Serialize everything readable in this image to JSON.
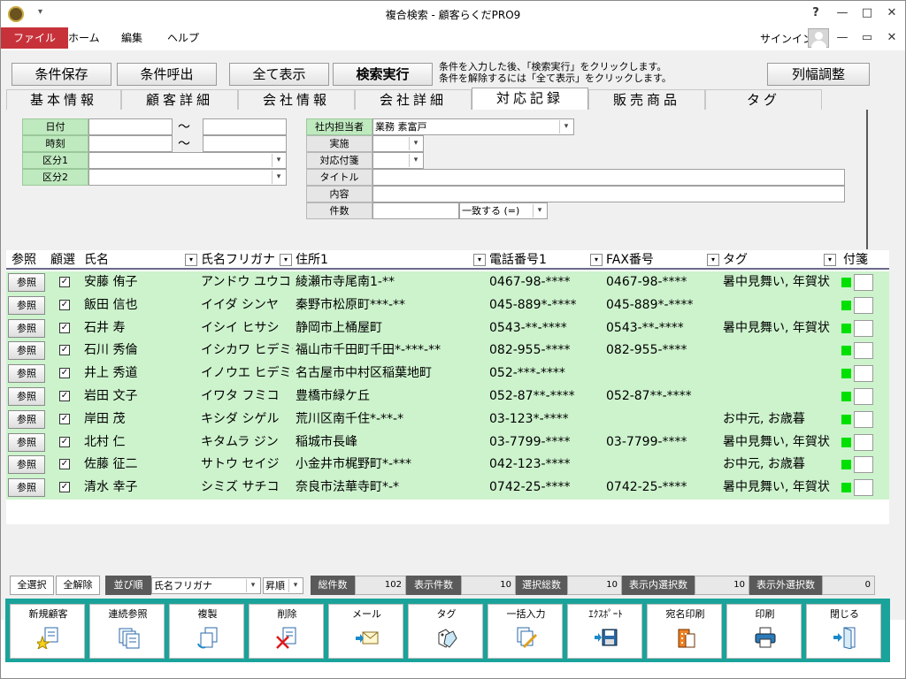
{
  "window": {
    "title": "複合検索 - 顧客らくだPRO9",
    "signin": "サインイン",
    "help": "?",
    "minimize": "—",
    "maximize": "□",
    "close": "✕",
    "ribbon_min": "—",
    "ribbon_restore": "▭",
    "ribbon_close": "✕",
    "qa": "▾"
  },
  "menu": [
    "ファイル",
    "ホーム",
    "編集",
    "ヘルプ"
  ],
  "toolbar": {
    "save": "条件保存",
    "load": "条件呼出",
    "show_all": "全て表示",
    "execute": "検索実行",
    "hint1": "条件を入力した後、「検索実行」をクリックします。",
    "hint2": "条件を解除するには「全て表示」をクリックします。",
    "col_adjust": "列幅調整"
  },
  "tabs": [
    "基本情報",
    "顧客詳細",
    "会社情報",
    "会社詳細",
    "対応記録",
    "販売商品",
    "タグ"
  ],
  "search": {
    "date": "日付",
    "time": "時刻",
    "kubun1": "区分1",
    "kubun2": "区分2",
    "tilde": "〜",
    "tantou": "社内担当者",
    "tantou_val": "業務 素富戸",
    "jisshi": "実施",
    "fusen": "対応付箋",
    "title": "タイトル",
    "naiyou": "内容",
    "kensu": "件数",
    "match": "一致する (=)"
  },
  "columns": [
    "参照",
    "顧選",
    "氏名",
    "氏名フリガナ",
    "住所1",
    "電話番号1",
    "FAX番号",
    "タグ",
    "付箋"
  ],
  "ref_label": "参照",
  "rows": [
    {
      "name": "安藤 侑子",
      "kana": "アンドウ ユウコ",
      "addr": "綾瀬市寺尾南1-**",
      "tel": "0467-98-****",
      "fax": "0467-98-****",
      "tag": "暑中見舞い, 年賀状"
    },
    {
      "name": "飯田 信也",
      "kana": "イイダ シンヤ",
      "addr": "秦野市松原町***-**",
      "tel": "045-889*-****",
      "fax": "045-889*-****",
      "tag": ""
    },
    {
      "name": "石井 寿",
      "kana": "イシイ ヒサシ",
      "addr": "静岡市上桶屋町",
      "tel": "0543-**-****",
      "fax": "0543-**-****",
      "tag": "暑中見舞い, 年賀状"
    },
    {
      "name": "石川 秀倫",
      "kana": "イシカワ ヒデミチ",
      "addr": "福山市千田町千田*-***-**",
      "tel": "082-955-****",
      "fax": "082-955-****",
      "tag": ""
    },
    {
      "name": "井上 秀道",
      "kana": "イノウエ ヒデミチ",
      "addr": "名古屋市中村区稲葉地町",
      "tel": "052-***-****",
      "fax": "",
      "tag": ""
    },
    {
      "name": "岩田 文子",
      "kana": "イワタ フミコ",
      "addr": "豊橋市緑ケ丘",
      "tel": "052-87**-****",
      "fax": "052-87**-****",
      "tag": ""
    },
    {
      "name": "岸田 茂",
      "kana": "キシダ シゲル",
      "addr": "荒川区南千住*-**-*",
      "tel": "03-123*-****",
      "fax": "",
      "tag": "お中元, お歳暮"
    },
    {
      "name": "北村 仁",
      "kana": "キタムラ ジン",
      "addr": "稲城市長峰",
      "tel": "03-7799-****",
      "fax": "03-7799-****",
      "tag": "暑中見舞い, 年賀状"
    },
    {
      "name": "佐藤 征二",
      "kana": "サトウ セイジ",
      "addr": "小金井市梶野町*-***",
      "tel": "042-123-****",
      "fax": "",
      "tag": "お中元, お歳暮"
    },
    {
      "name": "清水 幸子",
      "kana": "シミズ サチコ",
      "addr": "奈良市法華寺町*-*",
      "tel": "0742-25-****",
      "fax": "0742-25-****",
      "tag": "暑中見舞い, 年賀状"
    }
  ],
  "status": {
    "select_all": "全選択",
    "deselect_all": "全解除",
    "sort": "並び順",
    "sort_val": "氏名フリガナ",
    "order": "昇順",
    "total_lbl": "総件数",
    "total": "102",
    "shown_lbl": "表示件数",
    "shown": "10",
    "sel_lbl": "選択総数",
    "sel": "10",
    "in_lbl": "表示内選択数",
    "in": "10",
    "out_lbl": "表示外選択数",
    "out": "0"
  },
  "actions": [
    "新規顧客",
    "連続参照",
    "複製",
    "削除",
    "メール",
    "タグ",
    "一括入力",
    "ｴｸｽﾎﾟｰﾄ",
    "宛名印刷",
    "印刷",
    "閉じる"
  ]
}
